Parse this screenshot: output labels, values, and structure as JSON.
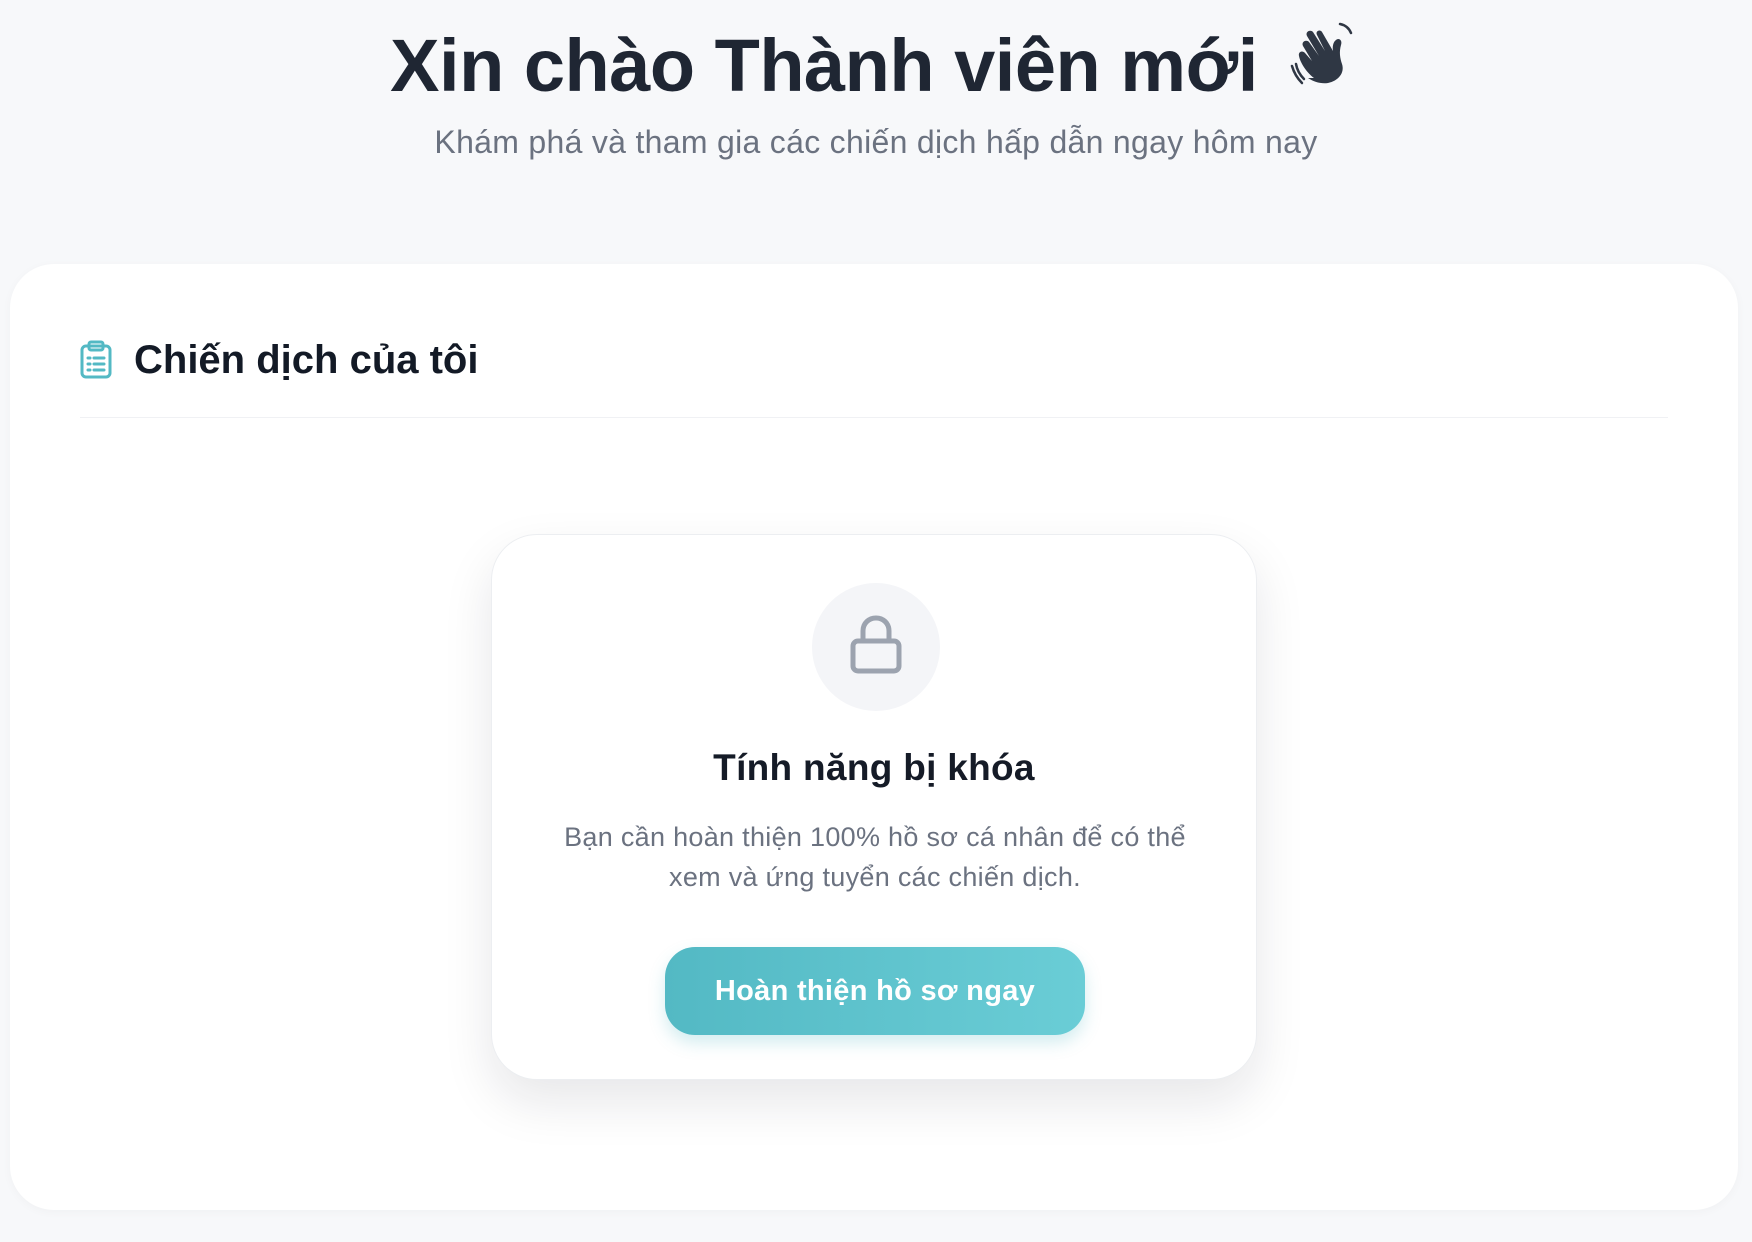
{
  "header": {
    "title": "Xin chào Thành viên mới",
    "wave_emoji": "👋",
    "subtitle": "Khám phá và tham gia các chiến dịch hấp dẫn ngay hôm nay"
  },
  "campaigns": {
    "title": "Chiến dịch của tôi",
    "icon": "clipboard-list-icon",
    "accent_color": "#53b9c4"
  },
  "locked": {
    "icon": "lock-icon",
    "title": "Tính năng bị khóa",
    "description": "Bạn cần hoàn thiện 100% hồ sơ cá nhân để có thể xem và ứng tuyển các chiến dịch.",
    "cta_label": "Hoàn thiện hồ sơ ngay"
  }
}
